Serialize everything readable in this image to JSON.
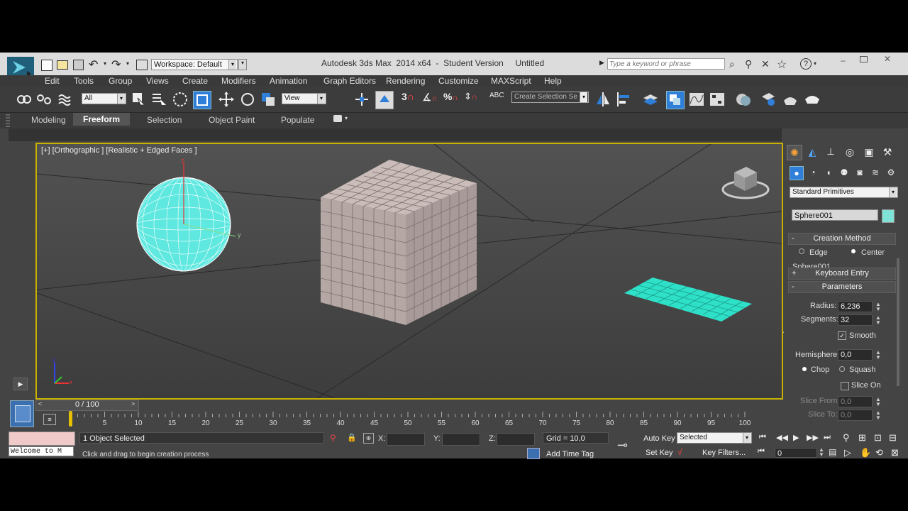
{
  "window": {
    "title": "Autodesk 3ds Max  2014 x64  -  Student Version     Untitled",
    "workspace": "Workspace: Default",
    "search_placeholder": "Type a keyword or phrase"
  },
  "menu": [
    "Edit",
    "Tools",
    "Group",
    "Views",
    "Create",
    "Modifiers",
    "Animation",
    "Graph Editors",
    "Rendering",
    "Customize",
    "MAXScript",
    "Help"
  ],
  "toolbar": {
    "selection_filter": "All",
    "reference_coord": "View",
    "named_selection": "Create Selection Se"
  },
  "ribbon_tabs": [
    "Modeling",
    "Freeform",
    "Selection",
    "Object Paint",
    "Populate"
  ],
  "viewport": {
    "label": "[+] [Orthographic ] [Realistic + Edged Faces ]",
    "axis_z": "z",
    "axis_y": "y",
    "axis_x": "x",
    "colors": {
      "sphere": "#5ee8e0",
      "plane": "#2fe0c8",
      "box": "#b8aaa8",
      "border": "#c8b100"
    }
  },
  "command_panel": {
    "category": "Standard Primitives",
    "object_name": "Sphere001",
    "object_color": "#7fe3d8",
    "creation_method": "Creation Method",
    "cm_edge": "Edge",
    "cm_center": "Center",
    "keyboard_entry": "Keyboard Entry",
    "parameters": "Parameters",
    "radius_label": "Radius:",
    "radius": "6,236",
    "segments_label": "Segments:",
    "segments": "32",
    "smooth": "Smooth",
    "hemisphere_label": "Hemisphere:",
    "hemisphere": "0,0",
    "chop": "Chop",
    "squash": "Squash",
    "slice_on": "Slice On",
    "slice_from_label": "Slice From:",
    "slice_from": "0,0",
    "slice_to_label": "Slice To:",
    "slice_to": "0,0",
    "rollout_minus": "-",
    "rollout_plus": "+"
  },
  "timeline": {
    "frame": "0 / 100",
    "ticks": [
      "5",
      "10",
      "15",
      "20",
      "25",
      "30",
      "35",
      "40",
      "45",
      "50",
      "55",
      "60",
      "65",
      "70",
      "75",
      "80",
      "85",
      "90",
      "95",
      "100"
    ]
  },
  "status": {
    "selected": "1 Object Selected",
    "prompt": "Click and drag to begin creation process",
    "maxscript": "Welcome to M",
    "x_label": "X:",
    "y_label": "Y:",
    "z_label": "Z:",
    "grid": "Grid = 10,0",
    "add_time_tag": "Add Time Tag",
    "auto_key": "Auto Key",
    "set_key": "Set Key",
    "key_mode": "Selected",
    "key_filters": "Key Filters...",
    "current_frame": "0"
  }
}
